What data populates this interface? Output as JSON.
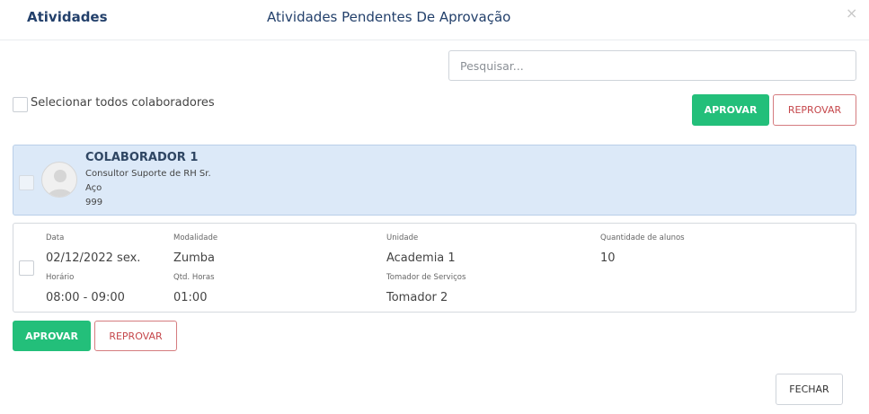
{
  "header": {
    "left_title": "Atividades",
    "title": "Atividades Pendentes De Aprovação",
    "close_glyph": "×"
  },
  "search": {
    "placeholder": "Pesquisar..."
  },
  "select_all": {
    "label": "Selecionar todos colaboradores"
  },
  "actions": {
    "approve_label": "APROVAR",
    "reject_label": "REPROVAR"
  },
  "collaborator": {
    "name": "COLABORADOR 1",
    "role": "Consultor Suporte de RH Sr.",
    "unit": "Aço",
    "code": "999",
    "avatar_icon": "user-avatar-icon"
  },
  "activity": {
    "date_label": "Data",
    "date_value": "02/12/2022 sex.",
    "modality_label": "Modalidade",
    "modality_value": "Zumba",
    "unit_label": "Unidade",
    "unit_value": "Academia 1",
    "students_label": "Quantidade de alunos",
    "students_value": "10",
    "time_label": "Horário",
    "time_value": "08:00 - 09:00",
    "hours_label": "Qtd. Horas",
    "hours_value": "01:00",
    "provider_label": "Tomador de Serviços",
    "provider_value": "Tomador 2"
  },
  "footer": {
    "close_label": "FECHAR"
  },
  "colors": {
    "approve": "#23bf7a",
    "reject": "#c5474b",
    "title": "#23406b",
    "card_highlight": "#dce9f8"
  }
}
